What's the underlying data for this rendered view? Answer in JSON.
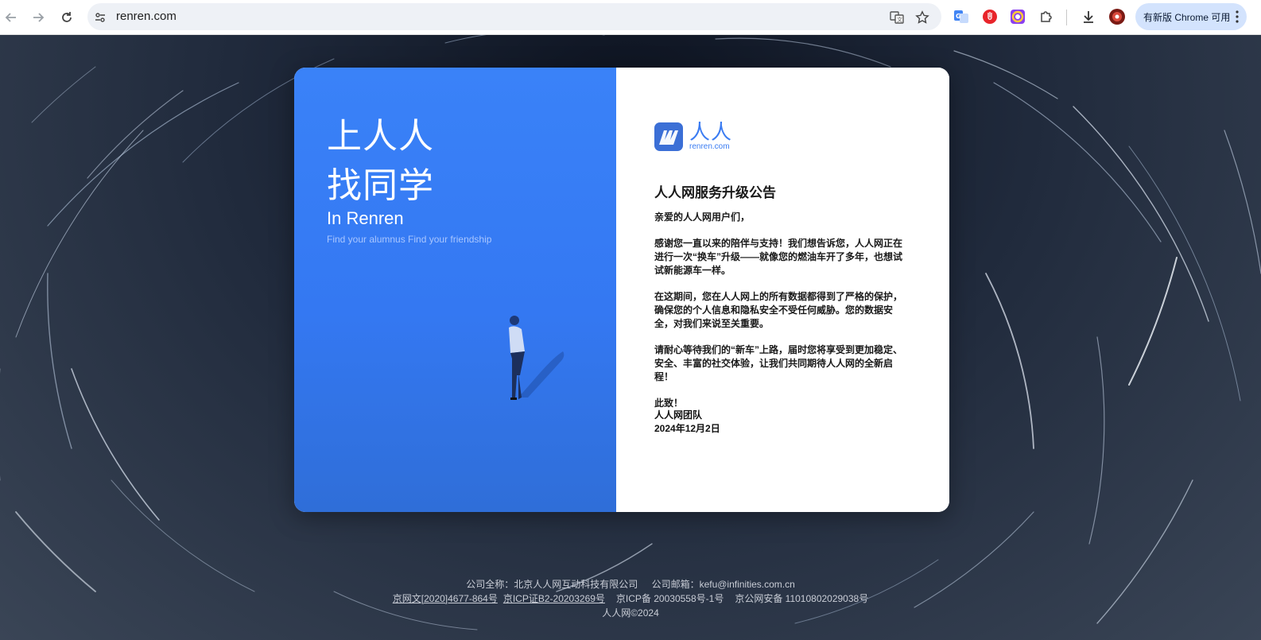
{
  "browser": {
    "url": "renren.com",
    "update_label": "有新版 Chrome 可用",
    "icons": [
      "back-icon",
      "forward-icon",
      "reload-icon",
      "site-info-icon",
      "translate-icon",
      "bookmark-star-icon",
      "google-translate-ext-icon",
      "adblock-ext-icon",
      "color-picker-ext-icon",
      "extensions-puzzle-icon",
      "download-icon",
      "profile-avatar-icon",
      "kebab-menu-icon"
    ]
  },
  "hero": {
    "line1": "上人人",
    "line2": "找同学",
    "subtitle": "In Renren",
    "tagline": "Find your alumnus Find your friendship"
  },
  "logo": {
    "cn": "人人",
    "en": "renren.com"
  },
  "notice": {
    "title": "人人网服务升级公告",
    "greeting": "亲爱的人人网用户们，",
    "p1": "感谢您一直以来的陪伴与支持！我们想告诉您，人人网正在进行一次“换车”升级——就像您的燃油车开了多年，也想试试新能源车一样。",
    "p2": "在这期间，您在人人网上的所有数据都得到了严格的保护，确保您的个人信息和隐私安全不受任何威胁。您的数据安全，对我们来说至关重要。",
    "p3": "请耐心等待我们的“新车”上路，届时您将享受到更加稳定、安全、丰富的社交体验，让我们共同期待人人网的全新启程！",
    "closing": "此致！",
    "team": "人人网团队",
    "date": "2024年12月2日"
  },
  "footer": {
    "company": "公司全称：北京人人网互动科技有限公司",
    "email": "公司邮箱：kefu@infinities.com.cn",
    "license1": "京网文[2020]4677-864号",
    "license2": "京ICP证B2-20203269号",
    "icp": "京ICP备 20030558号-1号",
    "police": "京公网安备 11010802029038号",
    "copyright": "人人网©2024"
  },
  "colors": {
    "brand_blue": "#3a82f8",
    "logo_blue": "#3b7cf2",
    "update_pill": "#d3e3fd"
  }
}
